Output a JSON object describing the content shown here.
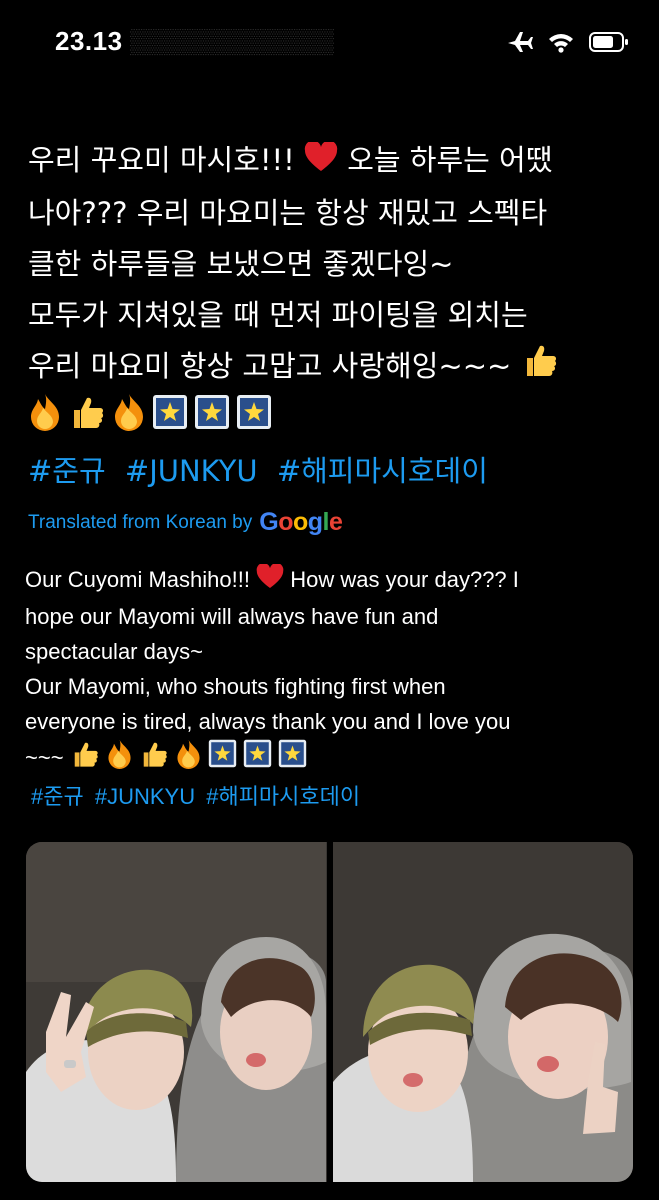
{
  "status_bar": {
    "time": "23.13",
    "icons": [
      "airplane-icon",
      "wifi-icon",
      "battery-icon"
    ]
  },
  "tweet": {
    "korean_lines": [
      "우리 꾸요미 마시호!!!",
      "나아??? 우리 마요미는 항상 재밌고 스펙타",
      "클한 하루들을 보냈으면 좋겠다잉~",
      "모두가 지쳐있을 때 먼저 파이팅을 외치는",
      "우리 마요미 항상 고맙고 사랑해잉~~~"
    ],
    "korean_line1_after_heart": "오늘 하루는 어땠",
    "korean_hashtags": [
      "#준규",
      "#JUNKYU",
      "#해피마시호데이"
    ],
    "translated_label": "Translated from Korean by",
    "translator": "Google",
    "english_line1_before_heart": "Our Cuyomi Mashiho!!!",
    "english_line1_after_heart": "How was your day??? I",
    "english_lines": [
      "hope our Mayomi will always have fun and",
      "spectacular days~",
      " Our Mayomi, who shouts fighting first when",
      "everyone is tired, always thank you and I love you"
    ],
    "english_last_line": "~~~",
    "english_hashtags": [
      "#준규",
      "#JUNKYU",
      "#해피마시호데이"
    ]
  },
  "media": {
    "photos": [
      "photo-1",
      "photo-2"
    ]
  },
  "colors": {
    "background": "#000000",
    "text": "#ffffff",
    "link": "#1d9bf0",
    "heart": "#e0202a"
  }
}
